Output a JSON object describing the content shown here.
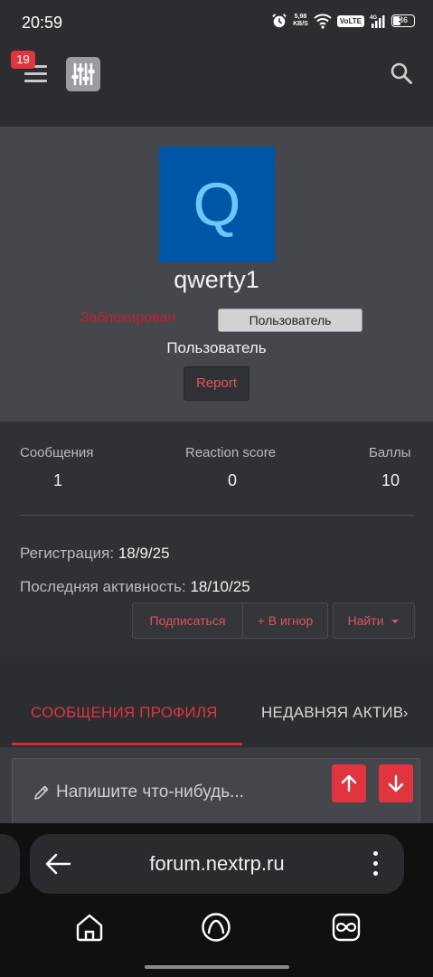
{
  "status_bar": {
    "time": "20:59",
    "net_speed_value": "5,98",
    "net_speed_unit": "KB/S",
    "volte": "VoLTE",
    "network": "4G",
    "battery": "36"
  },
  "header": {
    "notification_count": "19",
    "icons": [
      "menu-icon",
      "app-logo-sliders-icon",
      "search-icon"
    ]
  },
  "profile": {
    "avatar_letter": "Q",
    "avatar_bg": "#0056a6",
    "avatar_fg": "#6ec6ff",
    "username": "qwerty1",
    "banned_label": "Заблокирован",
    "user_title_badge": "Пользователь",
    "user_title": "Пользователь",
    "report_label": "Report"
  },
  "stats": {
    "messages_label": "Сообщения",
    "messages_value": "1",
    "reaction_label": "Reaction score",
    "reaction_value": "0",
    "points_label": "Баллы",
    "points_value": "10",
    "registered_label": "Регистрация:",
    "registered_value": "18/9/25",
    "last_activity_label": "Последняя активность:",
    "last_activity_value": "18/10/25",
    "follow_label": "Подписаться",
    "ignore_label": "+ В игнор",
    "find_label": "Найти"
  },
  "tabs": {
    "active": "СООБЩЕНИЯ ПРОФИЛЯ",
    "next": "НЕДАВНЯЯ АКТИВ"
  },
  "composer": {
    "placeholder": "Напишите что-нибудь..."
  },
  "browser": {
    "url": "forum.nextrp.ru"
  },
  "colors": {
    "accent": "#e0353f",
    "banned": "#c4212b",
    "header_bg": "#2b2d31",
    "profile_bg": "#45474d"
  }
}
